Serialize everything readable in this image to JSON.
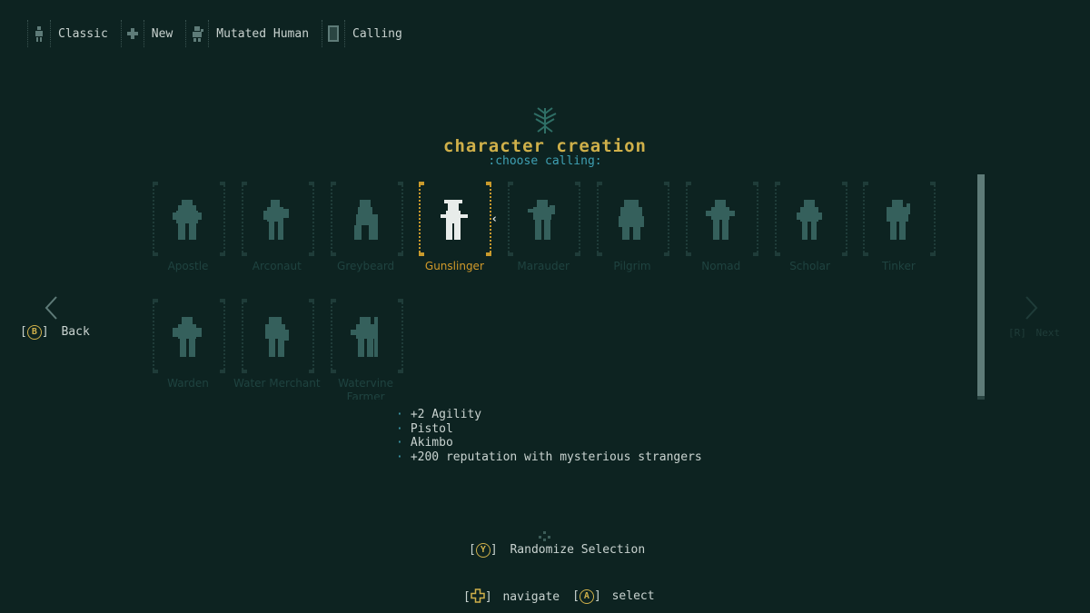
{
  "breadcrumbs": [
    {
      "label": "Classic",
      "icon": "classic-mode-icon"
    },
    {
      "label": "New",
      "icon": "plus-icon"
    },
    {
      "label": "Mutated Human",
      "icon": "mutant-icon"
    },
    {
      "label": "Calling",
      "icon": "calling-card-icon"
    }
  ],
  "header": {
    "emblem": "qud-tree-emblem-icon",
    "title": "character creation",
    "subtitle": ":choose calling:"
  },
  "callings": [
    {
      "name": "Apostle"
    },
    {
      "name": "Arconaut"
    },
    {
      "name": "Greybeard"
    },
    {
      "name": "Gunslinger",
      "selected": true
    },
    {
      "name": "Marauder"
    },
    {
      "name": "Pilgrim"
    },
    {
      "name": "Nomad"
    },
    {
      "name": "Scholar"
    },
    {
      "name": "Tinker"
    },
    {
      "name": "Warden"
    },
    {
      "name": "Water Merchant"
    },
    {
      "name": "Watervine Farmer"
    }
  ],
  "selection": {
    "selected_index": 3,
    "description": [
      "+2 Agility",
      "Pistol",
      "Akimbo",
      "+200 reputation with mysterious strangers"
    ]
  },
  "nav": {
    "back_button": "B",
    "back_label": "Back",
    "next_button": "R",
    "next_label": "Next"
  },
  "actions": {
    "randomize_button": "Y",
    "randomize_label": "Randomize Selection",
    "navigate_label": "navigate",
    "select_button": "A",
    "select_label": "select"
  },
  "colors": {
    "background": "#0d2321",
    "accent_gold": "#cfb04a",
    "accent_cyan": "#3fa0b3",
    "dim_tile": "#1f3c39"
  }
}
